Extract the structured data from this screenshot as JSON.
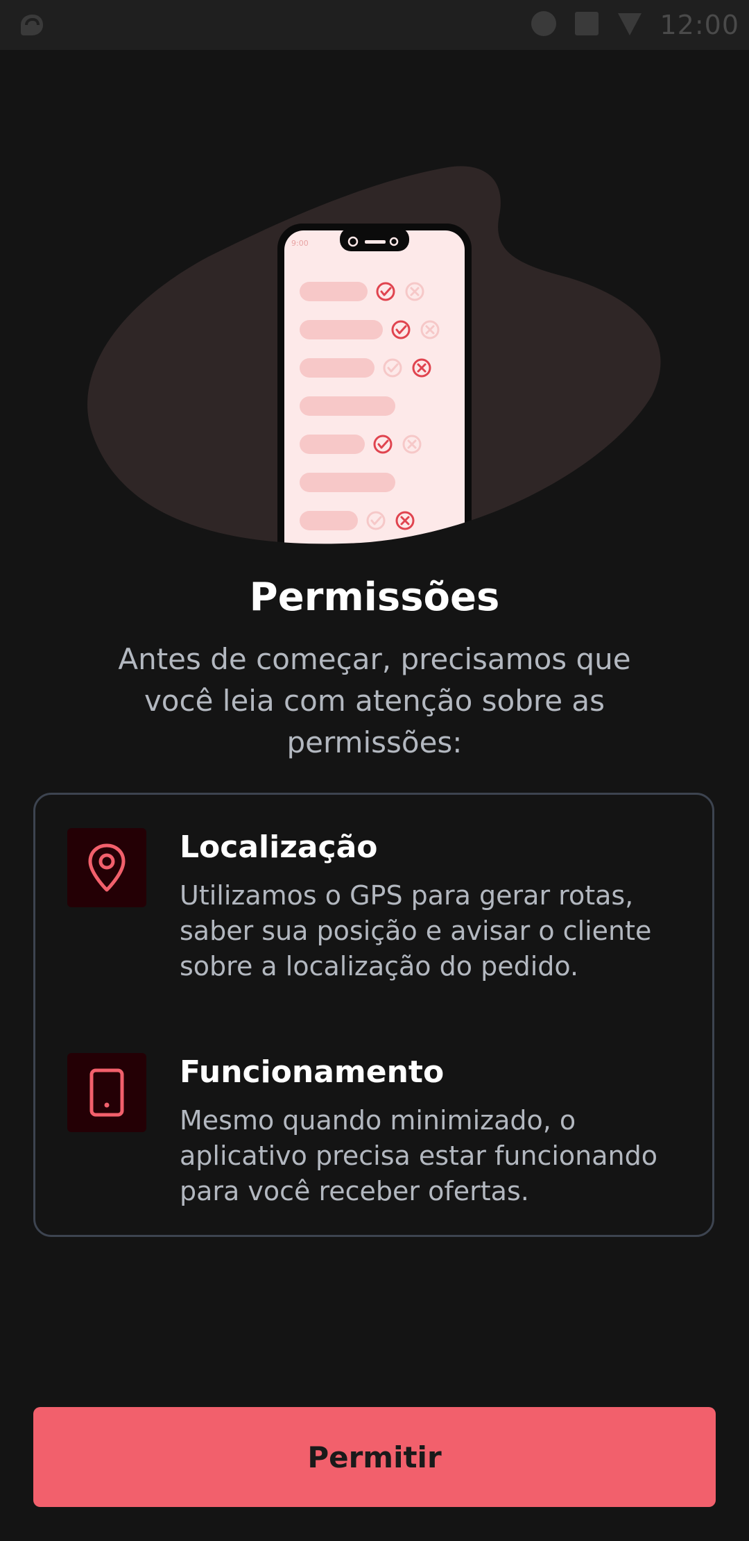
{
  "status_bar": {
    "time": "12:00",
    "icons": [
      "app-notification-icon",
      "circle-status-icon",
      "square-status-icon",
      "signal-icon"
    ]
  },
  "illustration": {
    "phone_time": "9:00",
    "rows": [
      {
        "state": "check"
      },
      {
        "state": "check"
      },
      {
        "state": "cross"
      },
      {
        "state": "none"
      },
      {
        "state": "check"
      },
      {
        "state": "none"
      },
      {
        "state": "cross"
      }
    ]
  },
  "page": {
    "title": "Permissões",
    "subtitle": "Antes de começar, precisamos que você leia com atenção sobre as permissões:"
  },
  "permissions": [
    {
      "icon": "location-pin-icon",
      "title": "Localização",
      "description": "Utilizamos o GPS para gerar rotas, saber sua posição e avisar o cliente sobre a localização do pedido."
    },
    {
      "icon": "smartphone-icon",
      "title": "Funcionamento",
      "description": "Mesmo quando minimizado, o aplicativo precisa estar funcionando para você receber ofertas."
    }
  ],
  "actions": {
    "allow_label": "Permitir"
  },
  "colors": {
    "background": "#141414",
    "accent": "#f2606c",
    "icon_tile": "#240005",
    "text_secondary": "#b3b8c0",
    "card_border": "#3d4450"
  }
}
